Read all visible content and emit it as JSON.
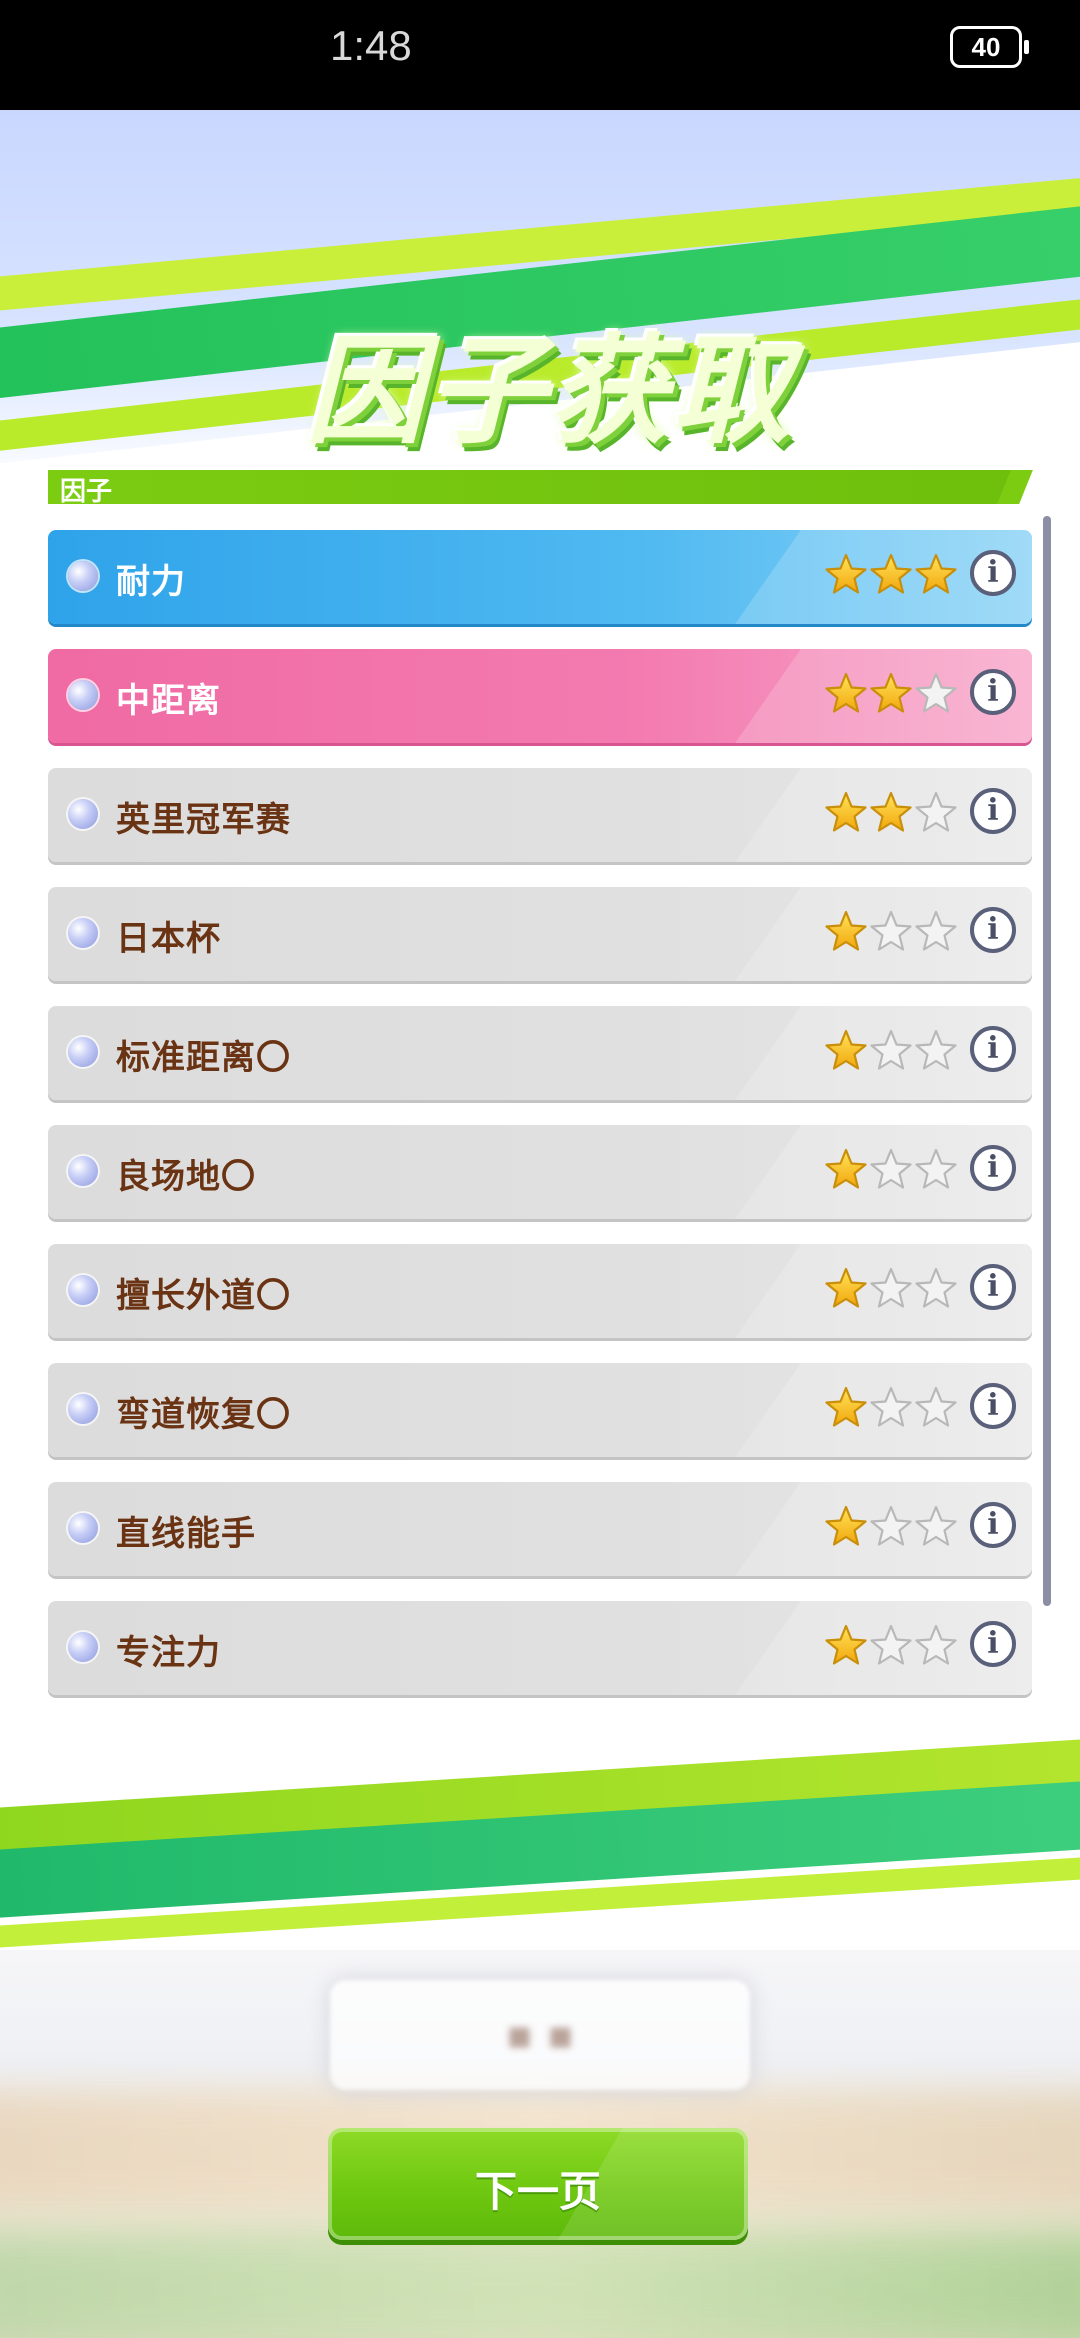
{
  "status_bar": {
    "time": "1:48",
    "battery": "40"
  },
  "title": "因子获取",
  "section": {
    "label": "因子"
  },
  "factors": [
    {
      "name": "耐力",
      "stars": 3,
      "style": "blue"
    },
    {
      "name": "中距离",
      "stars": 2,
      "style": "pink"
    },
    {
      "name": "英里冠军赛",
      "stars": 2,
      "style": "gray"
    },
    {
      "name": "日本杯",
      "stars": 1,
      "style": "gray"
    },
    {
      "name": "标准距离〇",
      "stars": 1,
      "style": "gray"
    },
    {
      "name": "良场地〇",
      "stars": 1,
      "style": "gray"
    },
    {
      "name": "擅长外道〇",
      "stars": 1,
      "style": "gray"
    },
    {
      "name": "弯道恢复〇",
      "stars": 1,
      "style": "gray"
    },
    {
      "name": "直线能手",
      "stars": 1,
      "style": "gray"
    },
    {
      "name": "专注力",
      "stars": 1,
      "style": "gray"
    }
  ],
  "max_stars": 3,
  "next_button": {
    "label": "下一页"
  },
  "colors": {
    "accent_green": "#7ccc12",
    "row_blue": "#2fa3ea",
    "row_pink": "#f06aa3",
    "text_brown": "#6a3414",
    "star_gold": "#f7c21a"
  }
}
